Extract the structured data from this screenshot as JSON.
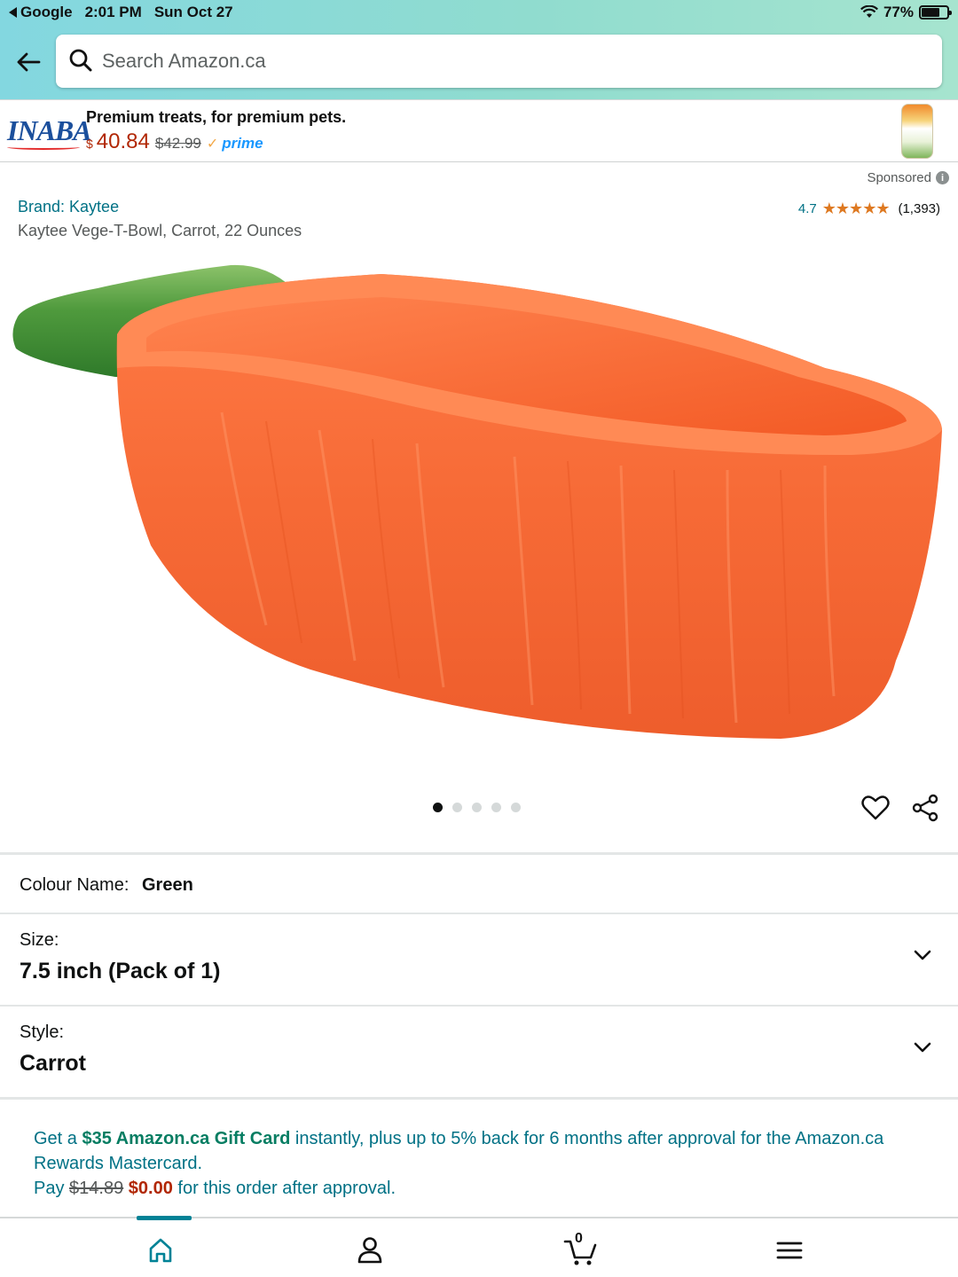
{
  "status_bar": {
    "back_app": "Google",
    "time": "2:01 PM",
    "date": "Sun Oct 27",
    "battery": "77%",
    "battery_level": 0.77
  },
  "search": {
    "placeholder": "Search Amazon.ca"
  },
  "ad": {
    "brand": "INABA",
    "tagline": "Premium treats, for premium pets.",
    "price_symbol": "$",
    "price": "40.84",
    "old_price": "$42.99",
    "prime_check": "✓",
    "prime_label": "prime"
  },
  "sponsored": {
    "label": "Sponsored",
    "info_glyph": "i"
  },
  "product": {
    "brand": "Brand: Kaytee",
    "title": "Kaytee Vege-T-Bowl, Carrot, 22 Ounces",
    "rating": "4.7",
    "stars": "★★★★★",
    "rating_count": "(1,393)",
    "image_count": 5,
    "active_image": 0
  },
  "options": {
    "colour_label": "Colour Name:",
    "colour_value": "Green",
    "size_label": "Size:",
    "size_value": "7.5 inch (Pack of 1)",
    "style_label": "Style:",
    "style_value": "Carrot"
  },
  "promo": {
    "prefix": "Get a ",
    "gift_card": "$35 Amazon.ca Gift Card",
    "middle": " instantly, plus up to 5% back for 6 months after approval for the Amazon.ca Rewards Mastercard.",
    "pay_prefix": "Pay ",
    "old_price": "$14.89",
    "new_price": "$0.00",
    "suffix": " for this order after approval."
  },
  "bottom_nav": {
    "items": [
      {
        "icon": "home-icon",
        "active": true
      },
      {
        "icon": "account-icon",
        "active": false
      },
      {
        "icon": "cart-icon",
        "active": false
      },
      {
        "icon": "menu-icon",
        "active": false
      }
    ],
    "cart_count": "0"
  },
  "colors": {
    "link": "#007185",
    "price": "#b12704",
    "star": "#de7921",
    "nav_accent": "#008296",
    "gift_green": "#067d62"
  }
}
